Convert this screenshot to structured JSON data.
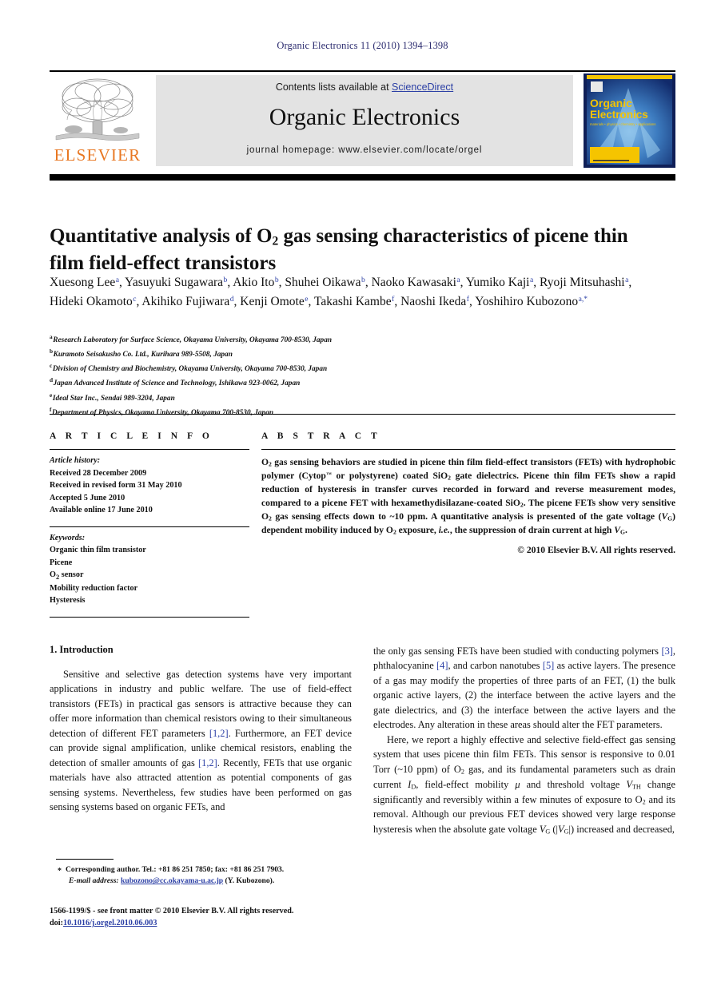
{
  "running_head": "Organic Electronics 11 (2010) 1394–1398",
  "masthead": {
    "contents_prefix": "Contents lists available at ",
    "contents_link": "ScienceDirect",
    "journal_title": "Organic Electronics",
    "homepage": "journal homepage: www.elsevier.com/locate/orgel",
    "publisher_name": "ELSEVIER",
    "cover_title_line1": "Organic",
    "cover_title_line2": "Electronics",
    "cover_subtitle": "materials • physics • chemistry • applications",
    "link_color": "#2b3fa5",
    "elsevier_orange": "#E87722"
  },
  "article": {
    "title_part1": "Quantitative analysis of O",
    "title_sub": "2",
    "title_part2": " gas sensing characteristics of picene thin film field-effect transistors",
    "authors": [
      {
        "name": "Xuesong Lee",
        "marks": "a",
        "sep": ", "
      },
      {
        "name": "Yasuyuki Sugawara",
        "marks": "b",
        "sep": ", "
      },
      {
        "name": "Akio Ito",
        "marks": "b",
        "sep": ", "
      },
      {
        "name": "Shuhei Oikawa",
        "marks": "b",
        "sep": ", "
      },
      {
        "name": "Naoko Kawasaki",
        "marks": "a",
        "sep": ", "
      },
      {
        "name": "Yumiko Kaji",
        "marks": "a",
        "sep": ", "
      },
      {
        "name": "Ryoji Mitsuhashi",
        "marks": "a",
        "sep": ", "
      },
      {
        "name": "Hideki Okamoto",
        "marks": "c",
        "sep": ", "
      },
      {
        "name": "Akihiko Fujiwara",
        "marks": "d",
        "sep": ", "
      },
      {
        "name": "Kenji Omote",
        "marks": "e",
        "sep": ", "
      },
      {
        "name": "Takashi Kambe",
        "marks": "f",
        "sep": ", "
      },
      {
        "name": "Naoshi Ikeda",
        "marks": "f",
        "sep": ", "
      },
      {
        "name": "Yoshihiro Kubozono",
        "marks": "a,*",
        "sep": ""
      }
    ],
    "affiliations": [
      {
        "mark": "a",
        "text": "Research Laboratory for Surface Science, Okayama University, Okayama 700-8530, Japan"
      },
      {
        "mark": "b",
        "text": "Kuramoto Seisakusho Co. Ltd., Kurihara 989-5508, Japan"
      },
      {
        "mark": "c",
        "text": "Division of Chemistry and Biochemistry, Okayama University, Okayama 700-8530, Japan"
      },
      {
        "mark": "d",
        "text": "Japan Advanced Institute of Science and Technology, Ishikawa 923-0062, Japan"
      },
      {
        "mark": "e",
        "text": "Ideal Star Inc., Sendai 989-3204, Japan"
      },
      {
        "mark": "f",
        "text": "Department of Physics, Okayama University, Okayama 700-8530, Japan"
      }
    ]
  },
  "article_info": {
    "heading": "A R T I C L E   I N F O",
    "history_label": "Article history:",
    "history": [
      "Received 28 December 2009",
      "Received in revised form 31 May 2010",
      "Accepted 5 June 2010",
      "Available online 17 June 2010"
    ],
    "keywords_label": "Keywords:",
    "keywords": [
      "Organic thin film transistor",
      "Picene",
      "O2 sensor",
      "Mobility reduction factor",
      "Hysteresis"
    ]
  },
  "abstract": {
    "heading": "A B S T R A C T",
    "text": "O2 gas sensing behaviors are studied in picene thin film field-effect transistors (FETs) with hydrophobic polymer (Cytop™ or polystyrene) coated SiO2 gate dielectrics. Picene thin film FETs show a rapid reduction of hysteresis in transfer curves recorded in forward and reverse measurement modes, compared to a picene FET with hexamethydisilazane-coated SiO2. The picene FETs show very sensitive O2 gas sensing effects down to ~10 ppm. A quantitative analysis is presented of the gate voltage (VG) dependent mobility induced by O2 exposure, i.e., the suppression of drain current at high VG.",
    "copyright": "© 2010 Elsevier B.V. All rights reserved."
  },
  "body": {
    "section_heading": "1. Introduction",
    "left_paragraph": "Sensitive and selective gas detection systems have very important applications in industry and public welfare. The use of field-effect transistors (FETs) in practical gas sensors is attractive because they can offer more information than chemical resistors owing to their simultaneous detection of different FET parameters [1,2]. Furthermore, an FET device can provide signal amplification, unlike chemical resistors, enabling the detection of smaller amounts of gas [1,2]. Recently, FETs that use organic materials have also attracted attention as potential components of gas sensing systems. Nevertheless, few studies have been performed on gas sensing systems based on organic FETs, and",
    "right_paragraph_1": "the only gas sensing FETs have been studied with conducting polymers [3], phthalocyanine [4], and carbon nanotubes [5] as active layers. The presence of a gas may modify the properties of three parts of an FET, (1) the bulk organic active layers, (2) the interface between the active layers and the gate dielectrics, and (3) the interface between the active layers and the electrodes. Any alteration in these areas should alter the FET parameters.",
    "right_paragraph_2": "Here, we report a highly effective and selective field-effect gas sensing system that uses picene thin film FETs. This sensor is responsive to 0.01 Torr (~10 ppm) of O2 gas, and its fundamental parameters such as drain current ID, field-effect mobility μ and threshold voltage VTH change significantly and reversibly within a few minutes of exposure to O2 and its removal. Although our previous FET devices showed very large response hysteresis when the absolute gate voltage VG (|VG|) increased and decreased,"
  },
  "footnote": {
    "marker": "*",
    "line1": "Corresponding author. Tel.: +81 86 251 7850; fax: +81 86 251 7903.",
    "email_label": "E-mail address:",
    "email": "kubozono@cc.okayama-u.ac.jp",
    "email_owner": "(Y. Kubozono)."
  },
  "imprint": {
    "line1": "1566-1199/$ - see front matter © 2010 Elsevier B.V. All rights reserved.",
    "doi_label": "doi:",
    "doi": "10.1016/j.orgel.2010.06.003"
  }
}
